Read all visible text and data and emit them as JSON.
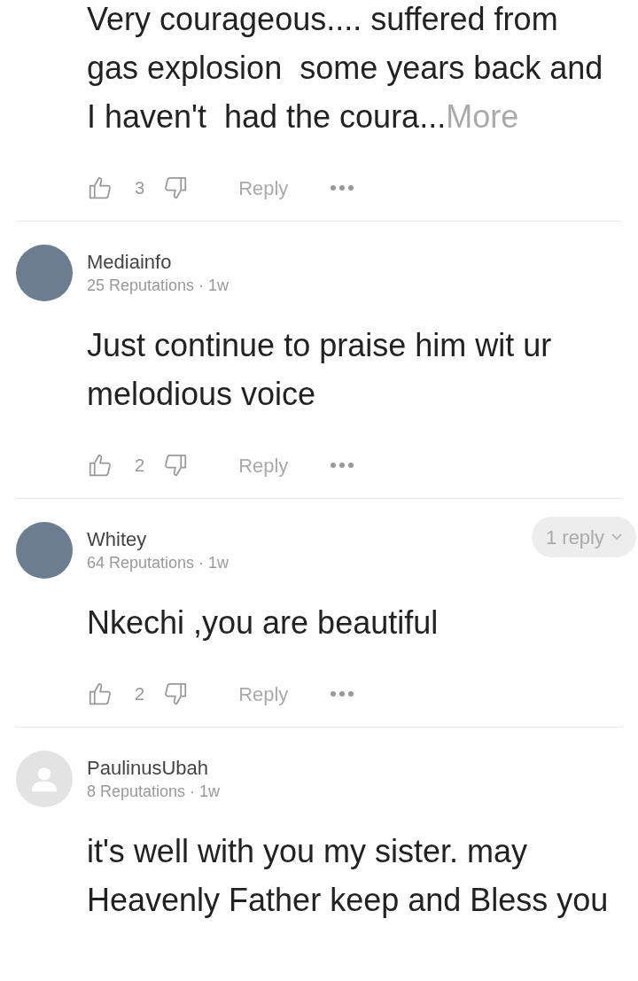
{
  "comments": [
    {
      "text": "Very courageous.... suffered from gas explosion  some years back and I haven't  had the coura...",
      "more": "More",
      "likes": "3",
      "reply": "Reply"
    },
    {
      "avatar": {
        "kind": "photo"
      },
      "author": "Mediainfo",
      "meta": "25 Reputations · 1w",
      "text": "Just continue to praise him wit ur melodious voice",
      "likes": "2",
      "reply": "Reply"
    },
    {
      "avatar": {
        "kind": "photo"
      },
      "author": "Whitey",
      "meta": "64 Reputations · 1w",
      "replies": "1 reply",
      "text": "Nkechi ,you are beautiful",
      "likes": "2",
      "reply": "Reply"
    },
    {
      "avatar": {
        "kind": "default"
      },
      "author": "PaulinusUbah",
      "meta": "8 Reputations · 1w",
      "text": "it's well with you my sister. may Heavenly Father keep and Bless you"
    }
  ]
}
